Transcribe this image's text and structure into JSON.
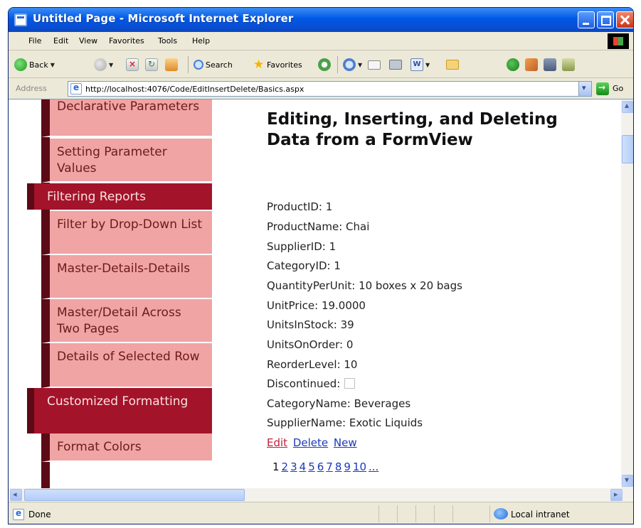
{
  "window": {
    "title": "Untitled Page - Microsoft Internet Explorer"
  },
  "menu": [
    {
      "label": "File"
    },
    {
      "label": "Edit"
    },
    {
      "label": "View"
    },
    {
      "label": "Favorites"
    },
    {
      "label": "Tools"
    },
    {
      "label": "Help"
    }
  ],
  "toolbar": {
    "back": "Back",
    "search": "Search",
    "favorites": "Favorites"
  },
  "address": {
    "label": "Address",
    "url": "http://localhost:4076/Code/EditInsertDelete/Basics.aspx",
    "go": "Go"
  },
  "nav": {
    "declarative": "Declarative Parameters",
    "setting_param": "Setting Parameter Values",
    "filtering": "Filtering Reports",
    "filter_dd": "Filter by Drop-Down List",
    "master_details": "Master-Details-Details",
    "master_across": "Master/Detail Across Two Pages",
    "details_selected": "Details of Selected Row",
    "customized": "Customized Formatting",
    "format_colors": "Format Colors"
  },
  "page": {
    "title": "Editing, Inserting, and Deleting Data from a FormView",
    "fields": [
      {
        "text": "ProductID: 1"
      },
      {
        "text": "ProductName: Chai"
      },
      {
        "text": "SupplierID: 1"
      },
      {
        "text": "CategoryID: 1"
      },
      {
        "text": "QuantityPerUnit: 10 boxes x 20 bags"
      },
      {
        "text": "UnitPrice: 19.0000"
      },
      {
        "text": "UnitsInStock: 39"
      },
      {
        "text": "UnitsOnOrder: 0"
      },
      {
        "text": "ReorderLevel: 10"
      },
      {
        "text": "Discontinued:"
      },
      {
        "text": "CategoryName: Beverages"
      },
      {
        "text": "SupplierName: Exotic Liquids"
      }
    ],
    "links": {
      "edit": "Edit",
      "delete": "Delete",
      "new": "New"
    },
    "pager": {
      "current": "1",
      "pages": [
        "2",
        "3",
        "4",
        "5",
        "6",
        "7",
        "8",
        "9",
        "10",
        "..."
      ]
    }
  },
  "status": {
    "text": "Done",
    "zone": "Local intranet"
  }
}
